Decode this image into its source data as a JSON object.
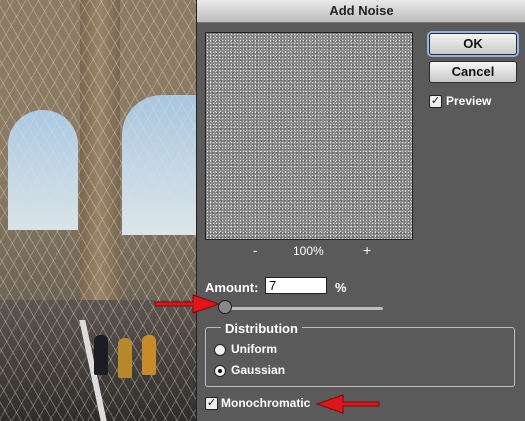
{
  "dialog": {
    "title": "Add Noise",
    "preview_zoom": "100%",
    "zoom_minus": "-",
    "zoom_plus": "+",
    "ok_label": "OK",
    "cancel_label": "Cancel",
    "preview_label": "Preview",
    "preview_checked": true,
    "amount_label": "Amount:",
    "amount_value": "7",
    "amount_unit": "%",
    "amount_slider_fraction": 0.07,
    "distribution": {
      "title": "Distribution",
      "options": [
        "Uniform",
        "Gaussian"
      ],
      "selected": "Gaussian"
    },
    "monochromatic_label": "Monochromatic",
    "monochromatic_checked": true
  },
  "colors": {
    "dialog_bg": "#5a5a5a",
    "annotation_arrow": "#e0141b",
    "ok_focus_ring": "#8fb6e6"
  },
  "icons": {
    "arrow_amount": "red-arrow-icon",
    "arrow_monochromatic": "red-arrow-icon"
  }
}
